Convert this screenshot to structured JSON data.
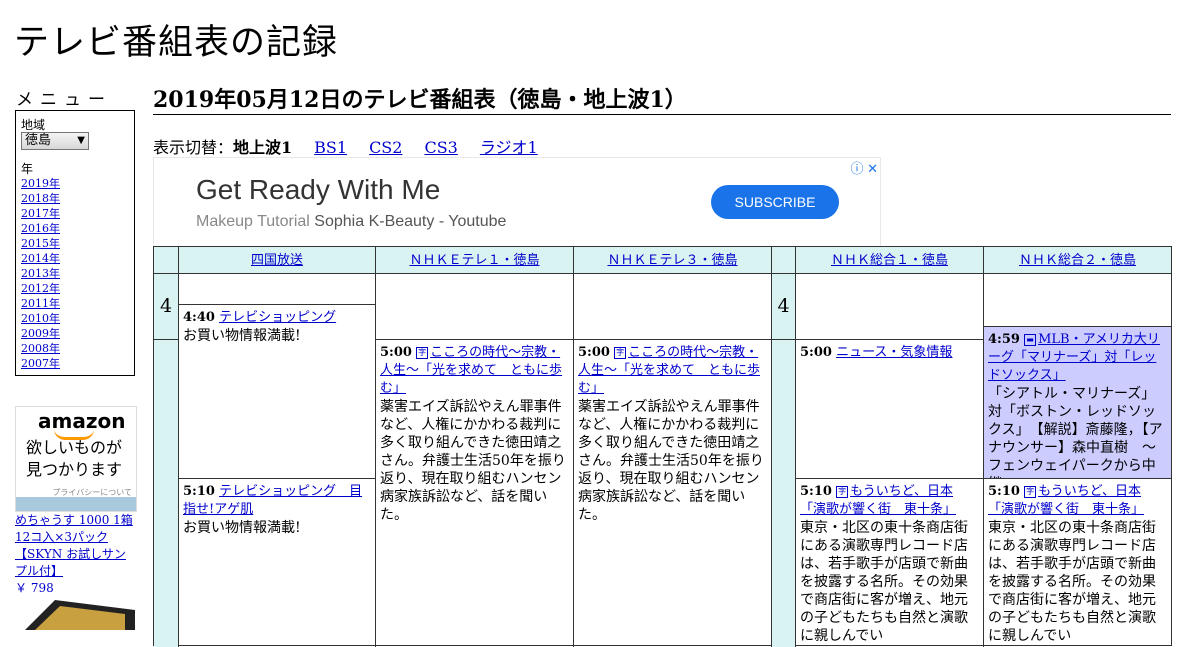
{
  "site_title": "テレビ番組表の記録",
  "sidebar": {
    "menu_heading": "メニュー",
    "region_label": "地域",
    "region_value": "徳島",
    "year_label": "年",
    "years": [
      "2019年",
      "2018年",
      "2017年",
      "2016年",
      "2015年",
      "2014年",
      "2013年",
      "2012年",
      "2011年",
      "2010年",
      "2009年",
      "2008年",
      "2007年"
    ],
    "ad": {
      "logo": "amazon",
      "tagline_1": "欲しいものが",
      "tagline_2": "見つかります",
      "privacy": "プライバシーについて",
      "product_title": "めちゃうす 1000 1箱12コ入×3パック 【SKYN お試しサンプル付】",
      "product_price": "￥ 798"
    }
  },
  "main": {
    "heading": "2019年05月12日のテレビ番組表（徳島・地上波1）",
    "switch_label": "表示切替：",
    "switch_current": "地上波1",
    "switch_links": [
      "BS1",
      "CS2",
      "CS3",
      "ラジオ1"
    ]
  },
  "ad_banner": {
    "headline": "Get Ready With Me",
    "sub_prefix": "Makeup Tutorial",
    "sub_source": "Sophia K-Beauty - Youtube",
    "button": "SUBSCRIBE",
    "icons": "ⓘ ✕"
  },
  "schedule": {
    "hour": "4",
    "channels": [
      "四国放送",
      "ＮＨＫＥテレ１・徳島",
      "ＮＨＫＥテレ３・徳島",
      "ＮＨＫ総合１・徳島",
      "ＮＨＫ総合２・徳島"
    ],
    "programs": {
      "shikoku_1": {
        "time": "4:40",
        "title": "テレビショッピング",
        "desc": "お買い物情報満載!"
      },
      "shikoku_2": {
        "time": "5:10",
        "title": "テレビショッピング　目指せ!アゲ肌",
        "desc": "お買い物情報満載!"
      },
      "etele1": {
        "time": "5:00",
        "title": "こころの時代～宗教・人生～「光を求めて　ともに歩む」",
        "desc": "薬害エイズ訴訟やえん罪事件など、人権にかかわる裁判に多く取り組んできた徳田靖之さん。弁護士生活50年を振り返り、現在取り組むハンセン病家族訴訟など、話を聞いた。"
      },
      "etele3": {
        "time": "5:00",
        "title": "こころの時代～宗教・人生～「光を求めて　ともに歩む」",
        "desc": "薬害エイズ訴訟やえん罪事件など、人権にかかわる裁判に多く取り組んできた徳田靖之さん。弁護士生活50年を振り返り、現在取り組むハンセン病家族訴訟など、話を聞いた。"
      },
      "sogo1_1": {
        "time": "5:00",
        "title": "ニュース・気象情報",
        "desc": ""
      },
      "sogo1_2": {
        "time": "5:10",
        "title": "もういちど、日本「演歌が響く街　東十条」",
        "desc": "東京・北区の東十条商店街にある演歌専門レコード店は、若手歌手が店頭で新曲を披露する名所。その効果で商店街に客が増え、地元の子どもたちも自然と演歌に親しんでい"
      },
      "sogo2_1": {
        "time": "4:59",
        "title": "MLB・アメリカ大リーグ「マリナーズ」対「レッドソックス」",
        "desc": "「シアトル・マリナーズ」対「ボストン・レッドソックス」　【解説】斎藤隆，【アナウンサー】森中直樹　～フェンウェイパークから中継～"
      },
      "sogo2_2": {
        "time": "5:10",
        "title": "もういちど、日本「演歌が響く街　東十条」",
        "desc": "東京・北区の東十条商店街にある演歌専門レコード店は、若手歌手が店頭で新曲を披露する名所。その効果で商店街に客が増え、地元の子どもたちも自然と演歌に親しんでい"
      }
    }
  }
}
